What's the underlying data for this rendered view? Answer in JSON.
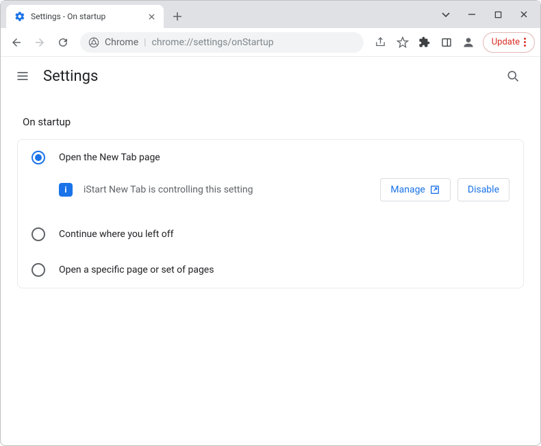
{
  "window": {
    "tab_title": "Settings - On startup"
  },
  "omnibox": {
    "prefix": "Chrome",
    "url": "chrome://settings/onStartup"
  },
  "update": {
    "label": "Update"
  },
  "header": {
    "title": "Settings"
  },
  "section": {
    "title": "On startup"
  },
  "options": {
    "new_tab": "Open the New Tab page",
    "continue": "Continue where you left off",
    "specific": "Open a specific page or set of pages"
  },
  "extension": {
    "notice": "iStart New Tab is controlling this setting",
    "manage": "Manage",
    "disable": "Disable"
  }
}
